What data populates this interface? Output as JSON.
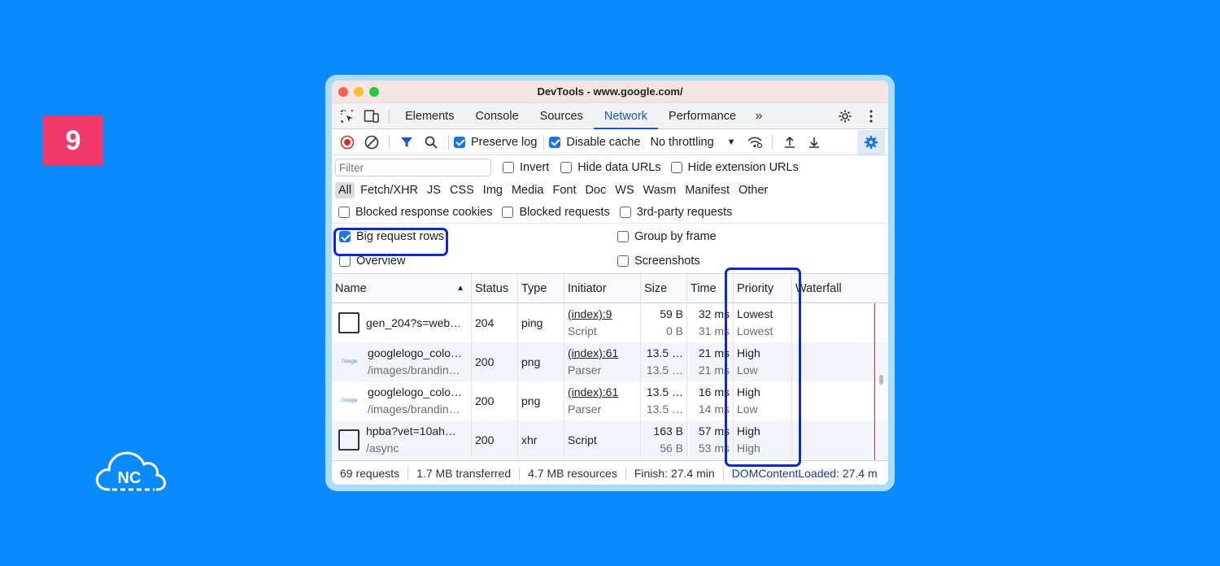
{
  "step_number": "9",
  "logo": {
    "text": "NC"
  },
  "window": {
    "title": "DevTools - www.google.com/"
  },
  "tabs": [
    "Elements",
    "Console",
    "Sources",
    "Network",
    "Performance"
  ],
  "active_tab": "Network",
  "toolbar": {
    "preserve_log": "Preserve log",
    "disable_cache": "Disable cache",
    "throttling": "No throttling"
  },
  "filter": {
    "placeholder": "Filter",
    "invert": "Invert",
    "hide_data_urls": "Hide data URLs",
    "hide_extension_urls": "Hide extension URLs"
  },
  "type_filters": [
    "All",
    "Fetch/XHR",
    "JS",
    "CSS",
    "Img",
    "Media",
    "Font",
    "Doc",
    "WS",
    "Wasm",
    "Manifest",
    "Other"
  ],
  "blocked": {
    "response_cookies": "Blocked response cookies",
    "requests": "Blocked requests",
    "third_party": "3rd-party requests"
  },
  "settings": {
    "big_request_rows": "Big request rows",
    "group_by_frame": "Group by frame",
    "overview": "Overview",
    "screenshots": "Screenshots"
  },
  "columns": {
    "name": "Name",
    "status": "Status",
    "type": "Type",
    "initiator": "Initiator",
    "size": "Size",
    "time": "Time",
    "priority": "Priority",
    "waterfall": "Waterfall"
  },
  "rows": [
    {
      "name": "gen_204?s=web…",
      "path": "",
      "status": "204",
      "type": "ping",
      "initiator": "(index):9",
      "initiator_type": "Script",
      "size": "59 B",
      "resource_size": "0 B",
      "time": "32 ms",
      "latency": "31 ms",
      "priority": "Lowest",
      "initial_priority": "Lowest"
    },
    {
      "name": "googlelogo_colo…",
      "path": "/images/brandin…",
      "status": "200",
      "type": "png",
      "initiator": "(index):61",
      "initiator_type": "Parser",
      "size": "13.5 …",
      "resource_size": "13.5 …",
      "time": "21 ms",
      "latency": "21 ms",
      "priority": "High",
      "initial_priority": "Low"
    },
    {
      "name": "googlelogo_colo…",
      "path": "/images/brandin…",
      "status": "200",
      "type": "png",
      "initiator": "(index):61",
      "initiator_type": "Parser",
      "size": "13.5 …",
      "resource_size": "13.5 …",
      "time": "16 ms",
      "latency": "14 ms",
      "priority": "High",
      "initial_priority": "Low"
    },
    {
      "name": "hpba?vet=10ah…",
      "path": "/async",
      "status": "200",
      "type": "xhr",
      "initiator": "Script",
      "initiator_type": "",
      "size": "163 B",
      "resource_size": "56 B",
      "time": "57 ms",
      "latency": "53 ms",
      "priority": "High",
      "initial_priority": "High"
    }
  ],
  "statusbar": {
    "requests": "69 requests",
    "transferred": "1.7 MB transferred",
    "resources": "4.7 MB resources",
    "finish": "Finish: 27.4 min",
    "dcl": "DOMContentLoaded: 27.4 m"
  },
  "colors": {
    "background": "#0a8aff",
    "badge": "#f0386b",
    "highlight": "#1128c8",
    "accent": "#1a73e8"
  }
}
